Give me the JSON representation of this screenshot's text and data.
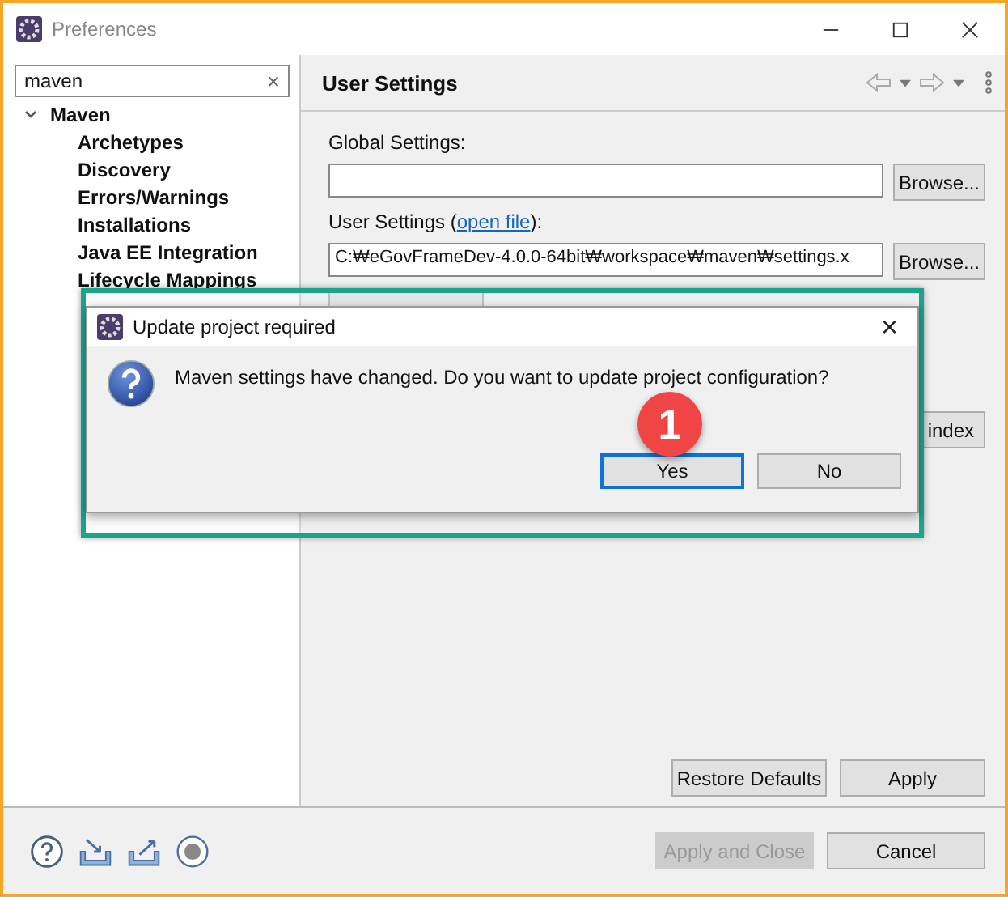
{
  "window": {
    "title": "Preferences"
  },
  "filter": {
    "value": "maven",
    "clear": "×"
  },
  "tree": [
    {
      "label": "Maven",
      "expanded": true,
      "selected": false,
      "children": [
        {
          "label": "Archetypes",
          "selected": false
        },
        {
          "label": "Discovery",
          "selected": false
        },
        {
          "label": "Errors/Warnings",
          "selected": false
        },
        {
          "label": "Installations",
          "selected": false
        },
        {
          "label": "Java EE Integration",
          "selected": false
        },
        {
          "label": "Lifecycle Mappings",
          "selected": false
        }
      ]
    }
  ],
  "page": {
    "title": "User Settings",
    "global_label": "Global Settings:",
    "global_browse": "Browse...",
    "user_label": "User Settings (",
    "user_link": "open file",
    "user_label_end": "):",
    "user_value": "C:₩eGovFrameDev-4.0.0-64bit₩workspace₩maven₩settings.x",
    "user_browse": "Browse...",
    "index_button": "index",
    "restore": "Restore Defaults",
    "apply": "Apply"
  },
  "footer": {
    "apply_close": {
      "label": "Apply and Close",
      "disabled": true
    },
    "cancel": {
      "label": "Cancel",
      "disabled": false
    }
  },
  "dialog": {
    "title": "Update project required",
    "close": "×",
    "message": "Maven settings have changed. Do you want to update project configuration?",
    "buttons": [
      {
        "label": "Yes",
        "selected": true
      },
      {
        "label": "No",
        "selected": false
      }
    ],
    "step_badge": "1"
  }
}
